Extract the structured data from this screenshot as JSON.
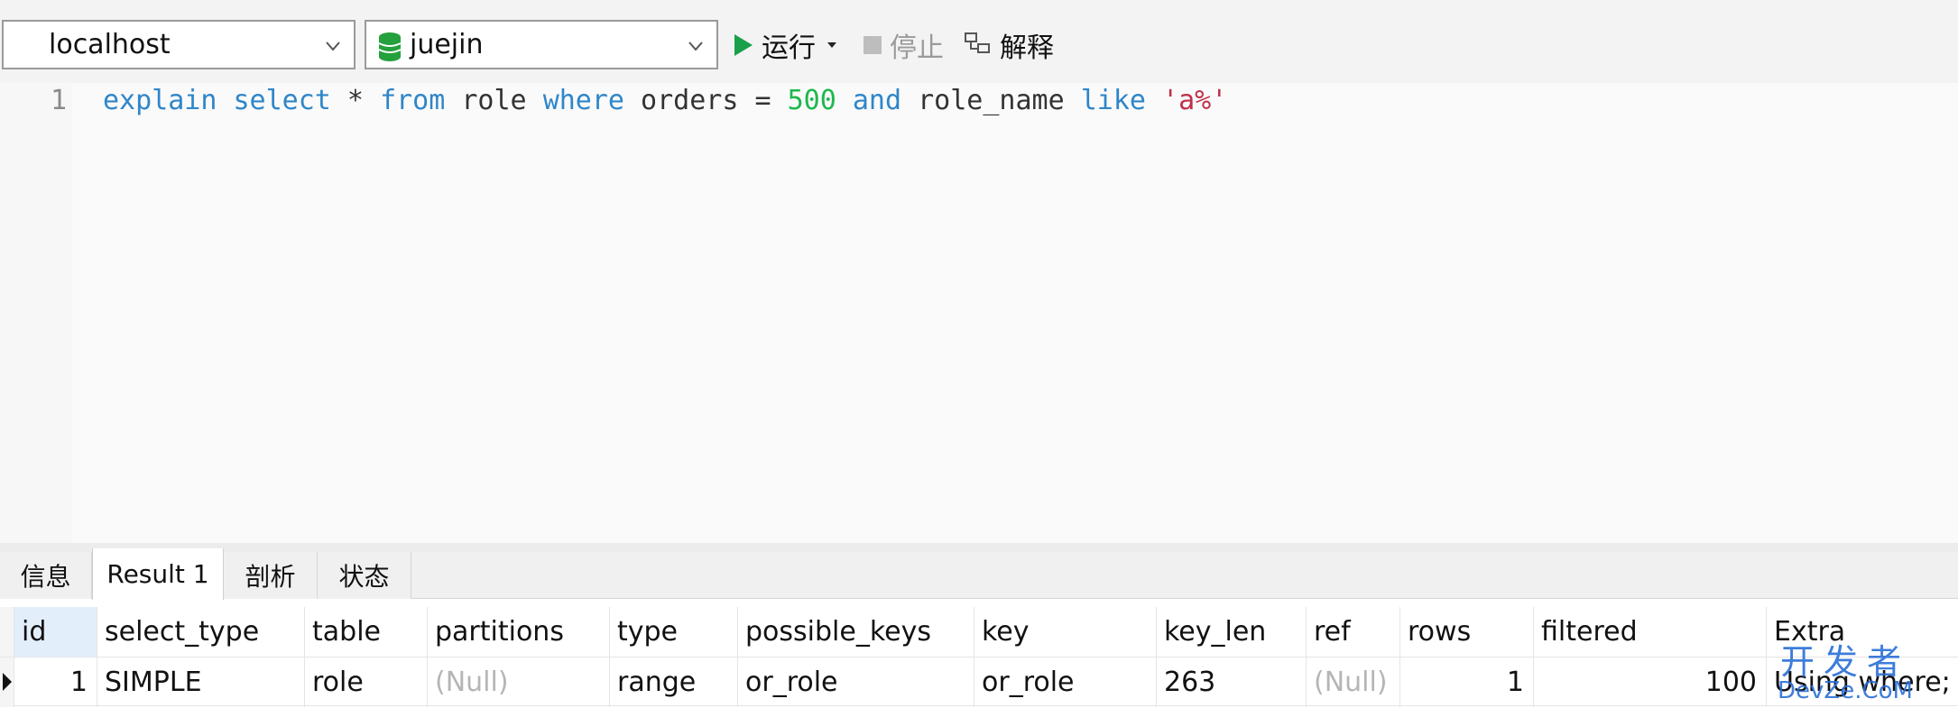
{
  "toolbar": {
    "connection": "localhost",
    "database": "juejin",
    "run_label": "运行",
    "stop_label": "停止",
    "explain_label": "解释",
    "colors": {
      "run": "#1aa04a",
      "db_icon": "#24a03c"
    }
  },
  "editor": {
    "line_number": "1",
    "tokens": [
      {
        "text": "explain",
        "kind": "kw"
      },
      {
        "text": " ",
        "kind": "ident"
      },
      {
        "text": "select",
        "kind": "kw"
      },
      {
        "text": " * ",
        "kind": "ident"
      },
      {
        "text": "from",
        "kind": "kw"
      },
      {
        "text": " role ",
        "kind": "ident"
      },
      {
        "text": "where",
        "kind": "kw"
      },
      {
        "text": " orders = ",
        "kind": "ident"
      },
      {
        "text": "500",
        "kind": "num"
      },
      {
        "text": " ",
        "kind": "ident"
      },
      {
        "text": "and",
        "kind": "kw"
      },
      {
        "text": " role_name ",
        "kind": "ident"
      },
      {
        "text": "like",
        "kind": "kw"
      },
      {
        "text": " ",
        "kind": "ident"
      },
      {
        "text": "'a%'",
        "kind": "str"
      }
    ]
  },
  "tabs": [
    {
      "label": "信息",
      "active": false
    },
    {
      "label": "Result 1",
      "active": true
    },
    {
      "label": "剖析",
      "active": false
    },
    {
      "label": "状态",
      "active": false
    }
  ],
  "result": {
    "columns": [
      "id",
      "select_type",
      "table",
      "partitions",
      "type",
      "possible_keys",
      "key",
      "key_len",
      "ref",
      "rows",
      "filtered",
      "Extra"
    ],
    "rows": [
      [
        "1",
        "SIMPLE",
        "role",
        "(Null)",
        "range",
        "or_role",
        "or_role",
        "263",
        "(Null)",
        "1",
        "100",
        "Using where; U"
      ]
    ]
  },
  "watermark": {
    "top": "开发者",
    "bottom": "DevZe.CoM"
  }
}
